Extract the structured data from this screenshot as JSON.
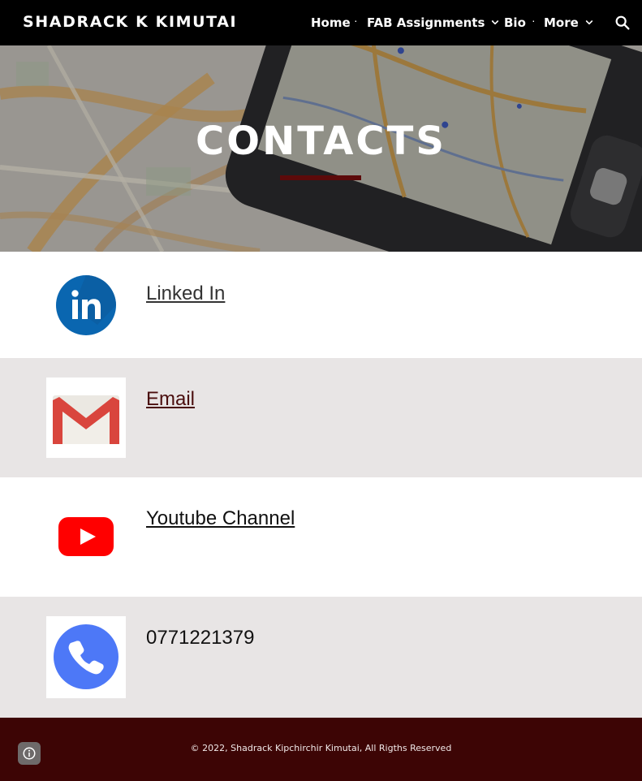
{
  "header": {
    "site_title": "SHADRACK K KIMUTAI",
    "nav": {
      "home": "Home",
      "fab_assignments": "FAB Assignments",
      "bio": "Bio",
      "more": "More",
      "separator": "·"
    },
    "search_icon": "search-icon"
  },
  "banner": {
    "title": "CONTACTS",
    "accent_color": "#5c0a0a"
  },
  "contacts": {
    "linkedin": {
      "label": "Linked In",
      "icon": "linkedin-icon",
      "color": "#333333"
    },
    "email": {
      "label": "Email",
      "icon": "gmail-icon",
      "color": "#4a0d0d"
    },
    "youtube": {
      "label": "Youtube Channel",
      "icon": "youtube-icon",
      "color": "#111111"
    },
    "phone": {
      "label": "0771221379",
      "icon": "phone-icon"
    }
  },
  "footer": {
    "copyright": "© 2022, Shadrack Kipchirchir Kimutai, All Rigths Reserved",
    "background": "#3d0505",
    "info_icon": "info-icon"
  }
}
